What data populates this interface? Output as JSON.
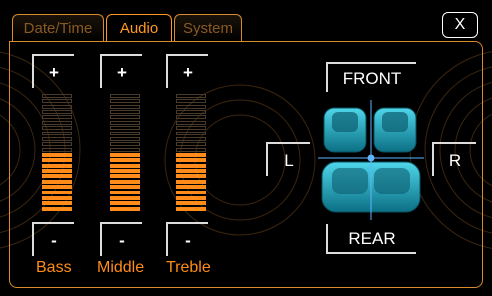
{
  "tabs": [
    {
      "label": "Date/Time",
      "active": false
    },
    {
      "label": "Audio",
      "active": true
    },
    {
      "label": "System",
      "active": false
    }
  ],
  "close_label": "X",
  "equalizer": {
    "plus_label": "+",
    "minus_label": "-",
    "bands": [
      {
        "label": "Bass",
        "level_segments": 11,
        "total_segments": 22
      },
      {
        "label": "Middle",
        "level_segments": 11,
        "total_segments": 22
      },
      {
        "label": "Treble",
        "level_segments": 11,
        "total_segments": 22
      }
    ]
  },
  "balance": {
    "front_label": "FRONT",
    "rear_label": "REAR",
    "left_label": "L",
    "right_label": "R"
  },
  "colors": {
    "accent": "#ff8c1a",
    "level_on": "#ff8c1a",
    "level_off": "#4a3a2a",
    "seat": "#19b5d1"
  }
}
